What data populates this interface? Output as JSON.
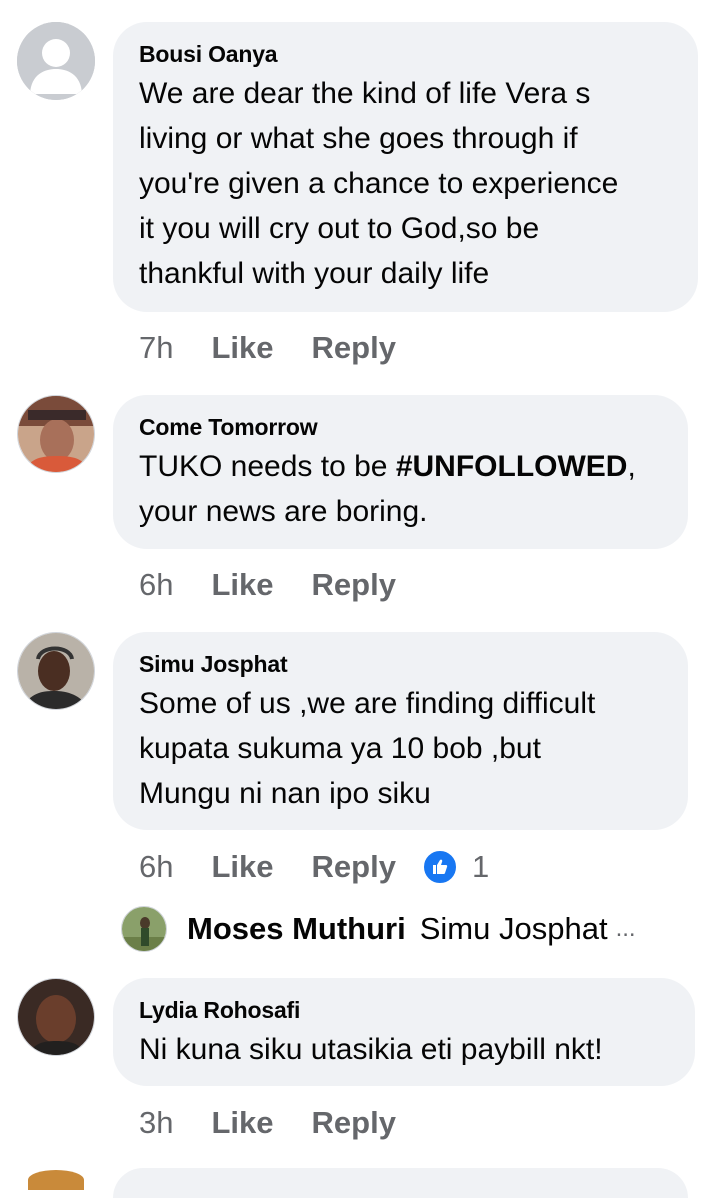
{
  "comments": [
    {
      "author": "Bousi Oanya",
      "text": "We are dear the kind of life Vera s\nliving or what she goes through if\nyou're given a chance to experience\nit you will cry out to God,so be\nthankful with your daily life",
      "time": "7h",
      "like_label": "Like",
      "reply_label": "Reply"
    },
    {
      "author": "Come Tomorrow",
      "text_before": "TUKO needs to be ",
      "text_bold": "#UNFOLLOWED",
      "text_after": ",\nyour news are boring.",
      "time": "6h",
      "like_label": "Like",
      "reply_label": "Reply"
    },
    {
      "author": "Simu Josphat",
      "text": "Some of us ,we are finding difficult\nkupata sukuma ya 10 bob ,but\nMungu ni nan ipo siku",
      "time": "6h",
      "like_label": "Like",
      "reply_label": "Reply",
      "reaction_icon": "like-reaction-icon",
      "reaction_count": "1",
      "reply_preview": {
        "author": "Moses Muthuri",
        "text": "Simu Josphat",
        "ellipsis": "..."
      }
    },
    {
      "author": "Lydia Rohosafi",
      "text": "Ni kuna siku utasikia eti paybill nkt!",
      "time": "3h",
      "like_label": "Like",
      "reply_label": "Reply"
    }
  ],
  "colors": {
    "bubble": "#f0f2f5",
    "secondary_text": "#65676b",
    "like_blue": "#1877f2"
  }
}
